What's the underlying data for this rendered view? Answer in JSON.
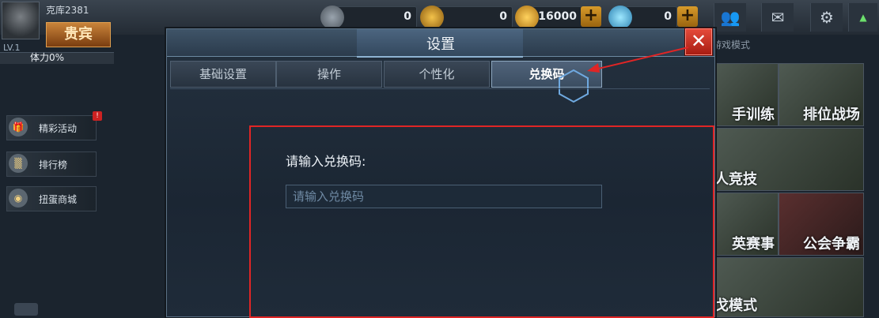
{
  "player": {
    "name": "克库2381",
    "vip_label": "贵宾",
    "level": "LV.1",
    "stamina": "体力0%"
  },
  "resources": [
    {
      "name": "rank-points",
      "value": "0",
      "icon": "triangle-emblem-icon"
    },
    {
      "name": "gold-medal",
      "value": "0",
      "icon": "gold-medal-icon"
    },
    {
      "name": "coins",
      "value": "16000",
      "icon": "coin-icon"
    },
    {
      "name": "diamonds",
      "value": "0",
      "icon": "diamond-icon"
    }
  ],
  "side_menu": [
    {
      "label": "精彩活动",
      "icon": "gift-icon",
      "badge": "!"
    },
    {
      "label": "排行榜",
      "icon": "podium-icon"
    },
    {
      "label": "扭蛋商城",
      "icon": "capsule-icon"
    }
  ],
  "modes": {
    "title": "游戏模式",
    "tiles": [
      "手训练",
      "排位战场",
      "人竞技",
      "英赛事",
      "公会争霸",
      "戈模式"
    ]
  },
  "modal": {
    "title": "设置",
    "close_label": "✕",
    "tabs": [
      {
        "label": "基础设置",
        "active": false
      },
      {
        "label": "操作",
        "active": false
      },
      {
        "label": "个性化",
        "active": false
      },
      {
        "label": "兑换码",
        "active": true
      }
    ],
    "redeem": {
      "label": "请输入兑换码:",
      "placeholder": "请输入兑换码",
      "value": ""
    }
  },
  "colors": {
    "accent_red": "#e02525",
    "modal_bg": "#1b2633",
    "active_tab": "#50637a"
  }
}
